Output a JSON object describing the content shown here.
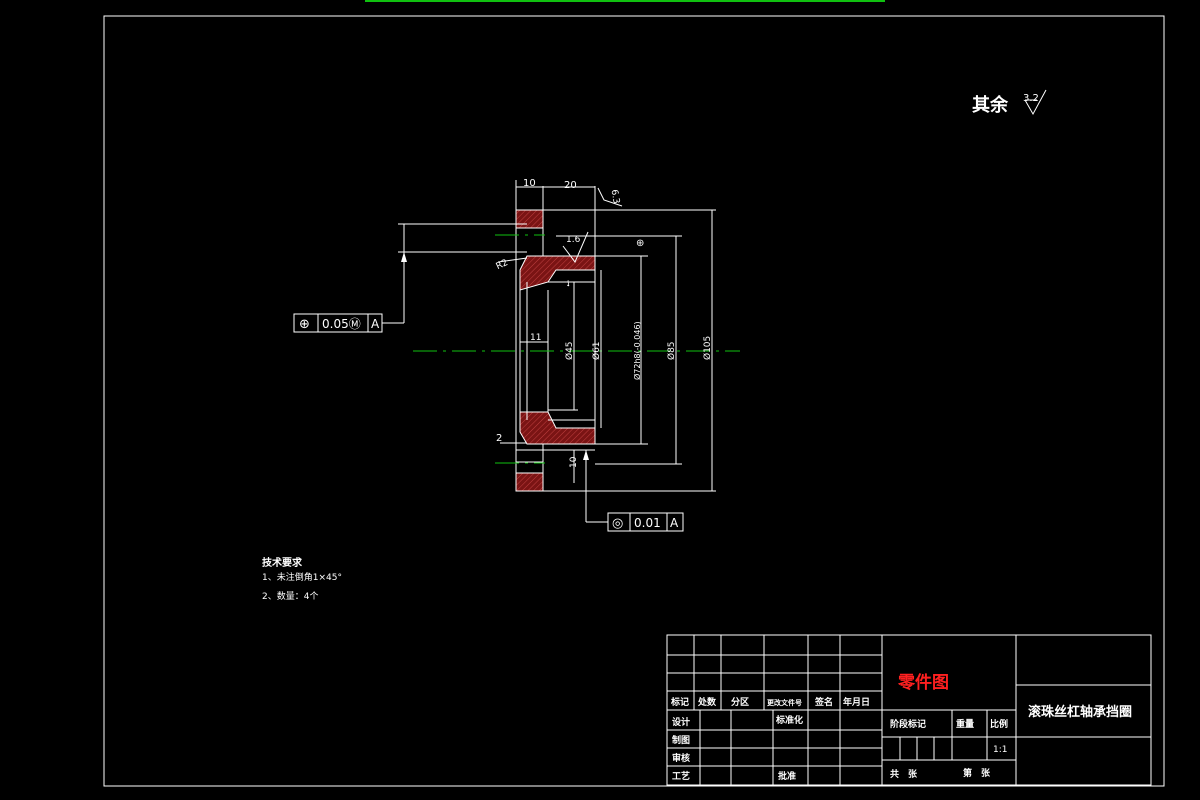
{
  "surface_finish": {
    "label": "其余",
    "value": "3.2"
  },
  "dimensions": {
    "flange_width": "10",
    "hub_length": "20",
    "roughness_top": "6.3",
    "roughness_inner": "1.6",
    "chamfer_r": "R2",
    "bore_dia": "Ø45",
    "bore_dia2": "Ø61",
    "fit_dia": "Ø72h8(-0.046)",
    "pitch_dia": "Ø85",
    "outer_dia": "Ø105",
    "step_len": "11",
    "chamfer_small": "2",
    "thickness_bottom": "10"
  },
  "tolerance_position": {
    "symbol": "⊕",
    "value": "0.05Ⓜ",
    "datum": "A"
  },
  "tolerance_concentric": {
    "symbol": "◎",
    "value": "0.01",
    "datum": "A"
  },
  "tech_requirements": {
    "title": "技术要求",
    "items": [
      "1、未注倒角1×45°",
      "2、数量：4个"
    ]
  },
  "title_block": {
    "drawing_type": "零件图",
    "part_name": "滚珠丝杠轴承挡圈",
    "header_row": [
      "标记",
      "处数",
      "分区",
      "更改文件号",
      "签名",
      "年月日"
    ],
    "roles": [
      "设计",
      "制图",
      "审核",
      "工艺"
    ],
    "standardize": "标准化",
    "approve": "批准",
    "stage_mark": "阶段标记",
    "weight": "重量",
    "scale_label": "比例",
    "scale_value": "1:1",
    "total_sheets": "共　张",
    "sheet_no": "第　张"
  },
  "colors": {
    "background": "#000000",
    "lines": "#ffffff",
    "center_line": "#10c010",
    "section_hatch": "#8b1a1a",
    "drawing_type": "#ff2020"
  }
}
